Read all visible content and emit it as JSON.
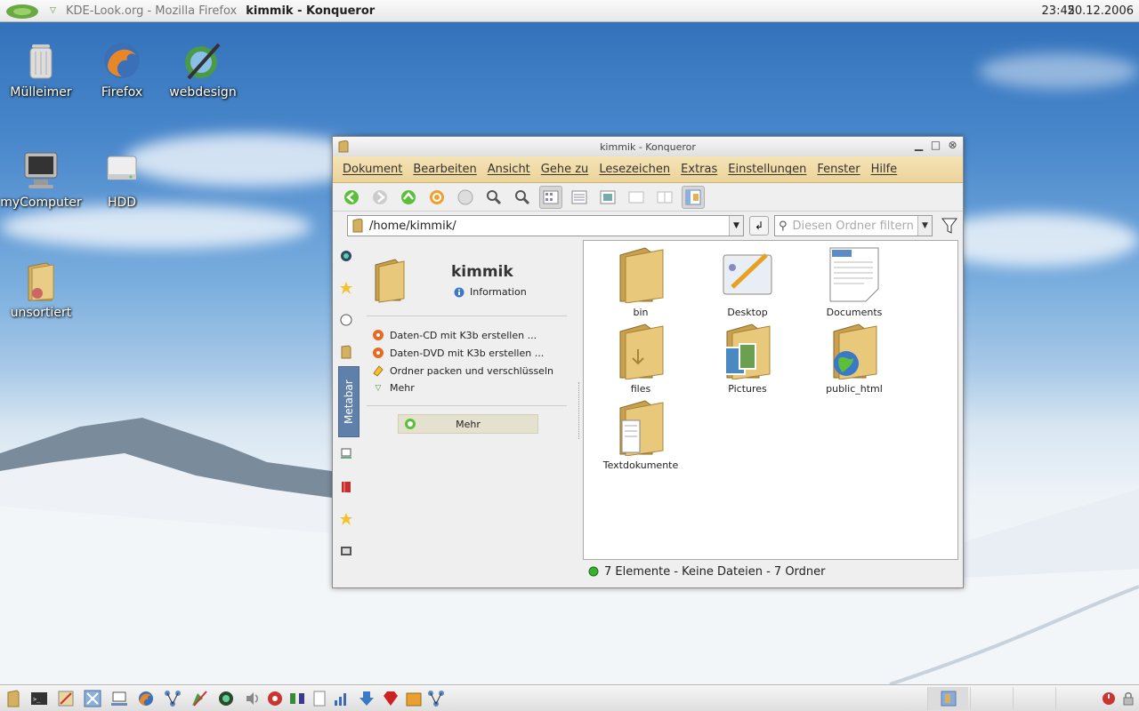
{
  "top_panel": {
    "taskbar_items": [
      {
        "label": "KDE-Look.org - Mozilla Firefox"
      },
      {
        "label": "kimmik - Konqueror"
      }
    ],
    "time": "23:45",
    "date": "20.12.2006"
  },
  "desktop_icons": [
    {
      "label": "Mülleimer",
      "icon": "trash-icon"
    },
    {
      "label": "Firefox",
      "icon": "firefox-icon"
    },
    {
      "label": "webdesign",
      "icon": "webdesign-icon"
    },
    {
      "label": "myComputer",
      "icon": "computer-icon"
    },
    {
      "label": "HDD",
      "icon": "hdd-icon"
    },
    {
      "label": "unsortiert",
      "icon": "folder-icon"
    }
  ],
  "window": {
    "title": "kimmik  -  Konqueror",
    "menu": [
      "Dokument",
      "Bearbeiten",
      "Ansicht",
      "Gehe zu",
      "Lesezeichen",
      "Extras",
      "Einstellungen",
      "Fenster",
      "Hilfe"
    ],
    "location": "/home/kimmik/",
    "filter_placeholder": "Diesen Ordner filtern",
    "metabar": {
      "tab_label": "Metabar",
      "folder_name": "kimmik",
      "info_label": "Information",
      "actions": [
        {
          "label": "Daten-CD mit K3b erstellen ..."
        },
        {
          "label": "Daten-DVD mit K3b erstellen ..."
        },
        {
          "label": "Ordner packen und verschlüsseln"
        },
        {
          "label": "Mehr"
        }
      ],
      "more_button": "Mehr"
    },
    "files": [
      {
        "name": "bin",
        "icon": "folder-icon"
      },
      {
        "name": "Desktop",
        "icon": "desktop-folder-icon"
      },
      {
        "name": "Documents",
        "icon": "document-icon"
      },
      {
        "name": "files",
        "icon": "download-folder-icon"
      },
      {
        "name": "Pictures",
        "icon": "pictures-folder-icon"
      },
      {
        "name": "public_html",
        "icon": "web-folder-icon"
      },
      {
        "name": "Textdokumente",
        "icon": "text-folder-icon"
      }
    ],
    "status": "7 Elemente - Keine Dateien - 7 Ordner"
  }
}
